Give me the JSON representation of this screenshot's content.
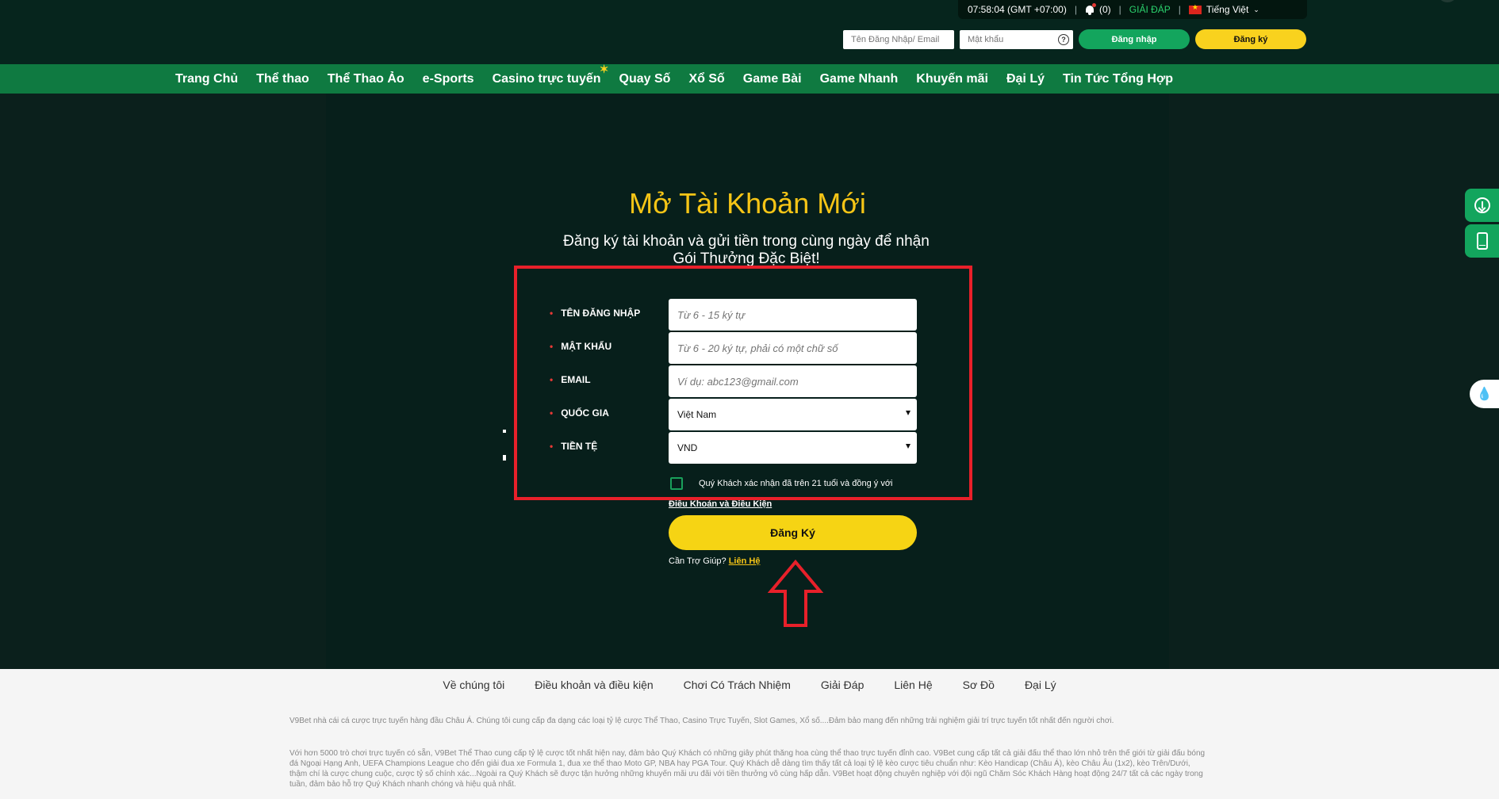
{
  "header": {
    "time": "07:58:04 (GMT +07:00)",
    "notifications": "(0)",
    "help": "GIẢI ĐÁP",
    "language": "Tiếng Việt",
    "username_placeholder": "Tên Đăng Nhập/ Email",
    "password_placeholder": "Mật khẩu",
    "login_label": "Đăng nhập",
    "register_label": "Đăng ký"
  },
  "nav": {
    "items": [
      "Trang Chủ",
      "Thể thao",
      "Thể Thao Ảo",
      "e-Sports",
      "Casino trực tuyến",
      "Quay Số",
      "Xổ Số",
      "Game Bài",
      "Game Nhanh",
      "Khuyến mãi",
      "Đại Lý",
      "Tin Tức Tổng Hợp"
    ]
  },
  "form": {
    "title": "Mở Tài Khoản Mới",
    "subtitle": "Đăng ký tài khoản và gửi tiền trong cùng ngày để nhận Gói Thưởng Đặc Biệt!",
    "username_label": "TÊN ĐĂNG NHẬP",
    "username_placeholder": "Từ 6 - 15 ký tự",
    "password_label": "MẬT KHẨU",
    "password_placeholder": "Từ 6 - 20 ký tự, phải có một chữ số",
    "email_label": "EMAIL",
    "email_placeholder": "Ví dụ: abc123@gmail.com",
    "country_label": "QUỐC GIA",
    "country_value": "Việt Nam",
    "currency_label": "TIỀN TỆ",
    "currency_value": "VND",
    "agree_text": "Quý Khách xác nhận đã trên 21 tuổi và đồng ý với",
    "terms_link": "Điều Khoản và Điều Kiện",
    "submit_label": "Đăng Ký",
    "help_text": "Cần Trợ Giúp?",
    "contact_link": "Liên Hệ"
  },
  "footer": {
    "links": [
      "Về chúng tôi",
      "Điều khoản và điều kiện",
      "Chơi Có Trách Nhiệm",
      "Giải Đáp",
      "Liên Hệ",
      "Sơ Đồ",
      "Đại Lý"
    ],
    "paragraph1": "V9Bet nhà cái cá cược trực tuyến hàng đầu Châu Á. Chúng tôi cung cấp đa dạng các loại tỷ lệ cược Thể Thao, Casino Trực Tuyến, Slot Games, Xổ số....Đảm bảo mang đến những trải nghiệm giải trí trực tuyến tốt nhất đến người chơi.",
    "paragraph2": "Với hơn 5000 trò chơi trực tuyến có sẵn, V9Bet Thể Thao cung cấp tỷ lệ cược tốt nhất hiện nay, đảm bảo Quý Khách có những giây phút thăng hoa cùng thể thao trực tuyến đỉnh cao. V9Bet cung cấp tất cả giải đấu thể thao lớn nhỏ trên thế giới từ giải đấu bóng đá Ngoại Hạng Anh, UEFA Champions League cho đến giải đua xe Formula 1, đua xe thể thao Moto GP, NBA hay PGA Tour. Quý Khách dễ dàng tìm thấy tất cả loại tỷ lệ kèo cược tiêu chuẩn như: Kèo Handicap (Châu Á), kèo Châu Âu (1x2), kèo Trên/Dưới, thậm chí là cược chung cuộc, cược tỷ số chính xác...Ngoài ra Quý Khách sẽ được tận hưởng những khuyến mãi ưu đãi với tiền thưởng vô cùng hấp dẫn. V9Bet hoạt động chuyên nghiệp với đội ngũ Chăm Sóc Khách Hàng hoạt động 24/7 tất cả các ngày trong tuần, đảm bảo hỗ trợ Quý Khách nhanh chóng và hiệu quả nhất."
  },
  "colors": {
    "brand_green": "#0f7a41",
    "accent_yellow": "#f6c516",
    "highlight_red": "#e8202a"
  }
}
